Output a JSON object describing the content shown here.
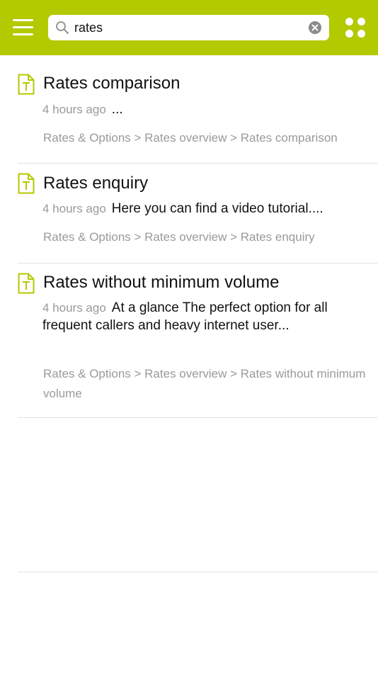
{
  "colors": {
    "accent": "#b3c900",
    "secondary_text": "#9a9a9a",
    "divider": "#e3e3e3"
  },
  "header": {
    "menu_icon": "hamburger-menu-icon",
    "search": {
      "icon": "search-icon",
      "value": "rates",
      "clear_icon": "clear-icon"
    },
    "apps_icon": "grid-apps-icon"
  },
  "results": [
    {
      "icon": "text-document-icon",
      "title": "Rates comparison",
      "time": "4 hours ago",
      "snippet": "...",
      "path": "Rates & Options > Rates overview > Rates comparison"
    },
    {
      "icon": "text-document-icon",
      "title": "Rates enquiry",
      "time": "4 hours ago",
      "snippet": "Here you can find a video tutorial....",
      "path": "Rates & Options > Rates overview > Rates enquiry"
    },
    {
      "icon": "text-document-icon",
      "title": "Rates without minimum volume",
      "time": "4 hours ago",
      "snippet": "At a glance The perfect option for all frequent callers and heavy internet user...",
      "path": "Rates & Options > Rates overview > Rates without minimum volume"
    }
  ]
}
